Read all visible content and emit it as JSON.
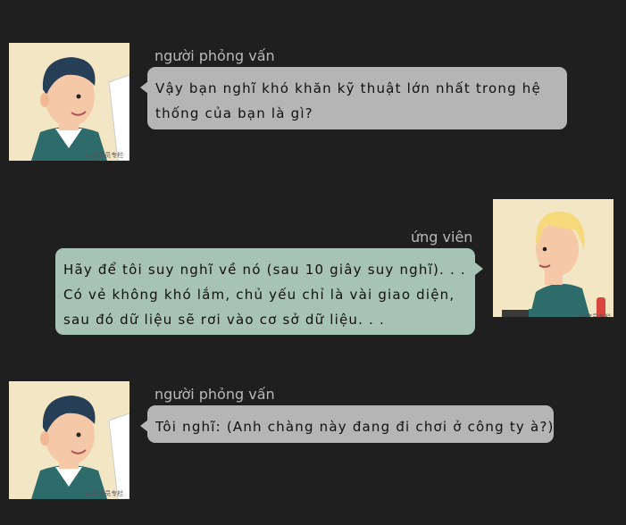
{
  "messages": [
    {
      "speaker": "người phỏng vấn",
      "lines": [
        "Vậy bạn nghĩ khó khăn kỹ thuật lớn nhất trong hệ",
        "thống của bạn là gì?"
      ]
    },
    {
      "speaker": "ứng viên",
      "lines": [
        "Hãy để tôi suy nghĩ về nó (sau 10 giây suy nghĩ). . .",
        "Có vẻ không khó lắm, chủ yếu chỉ là vài giao diện,",
        "sau đó dữ liệu sẽ rơi vào cơ sở dữ liệu. . ."
      ]
    },
    {
      "speaker": "người phỏng vấn",
      "lines": [
        "Tôi nghĩ: (Anh chàng này đang đi chơi ở công ty à?)"
      ]
    }
  ],
  "colors": {
    "background": "#1f1f1f",
    "interviewer_bubble": "#b5b5b5",
    "candidate_bubble": "#a7c3b5",
    "avatar_bg": "#f3e6c4"
  },
  "icons": {
    "interviewer": "interviewer-avatar-icon",
    "candidate": "candidate-avatar-icon"
  }
}
